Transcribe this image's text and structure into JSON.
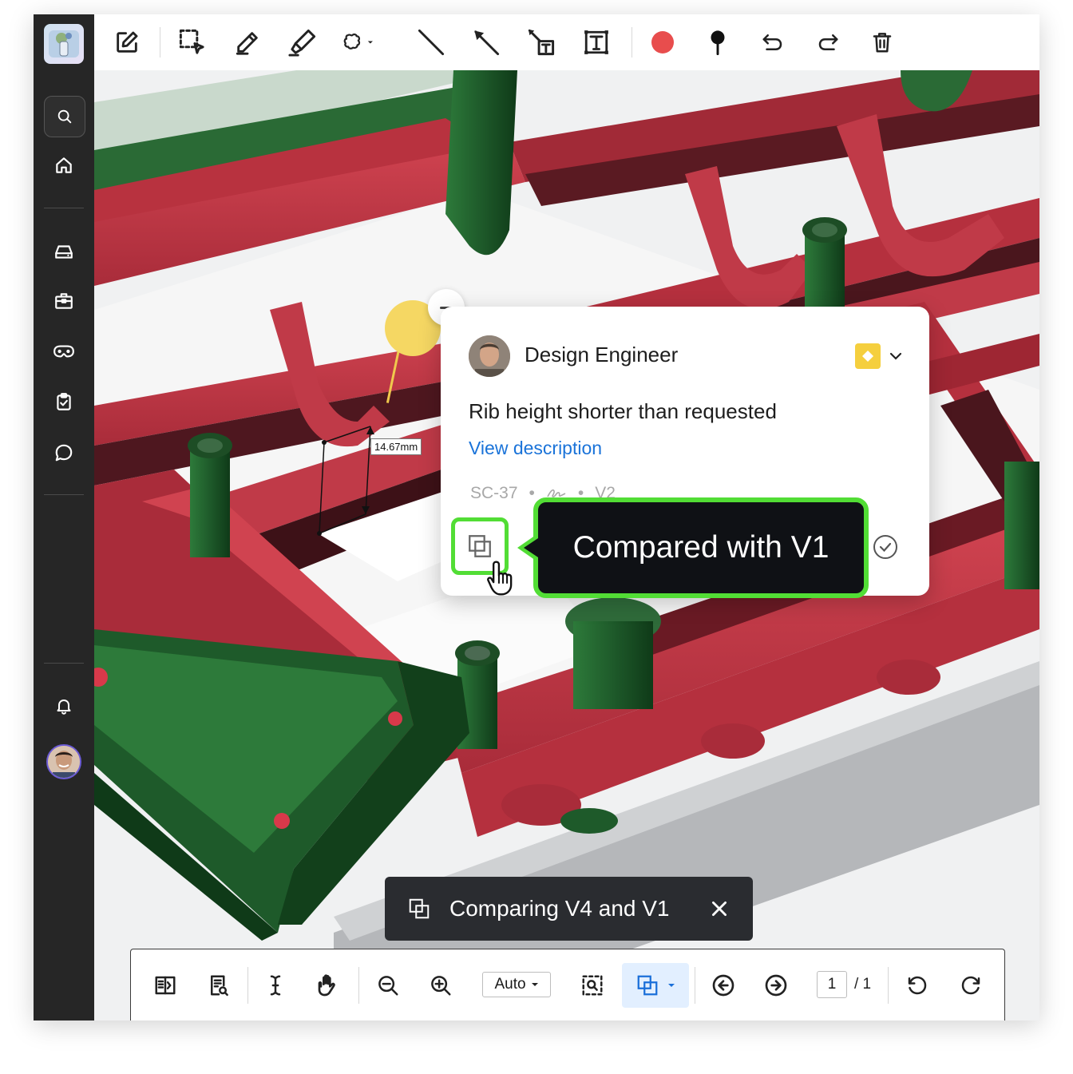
{
  "comment_card": {
    "author": "Design Engineer",
    "title": "Rib height shorter than requested",
    "link": "View description",
    "issue_id": "SC-37",
    "version": "V2"
  },
  "tooltip": {
    "text": "Compared with V1"
  },
  "measurement": {
    "label": "14.67mm"
  },
  "banner": {
    "text": "Comparing V4 and V1"
  },
  "bottom_toolbar": {
    "zoom_value": "Auto",
    "page_current": "1",
    "page_total": "/ 1"
  },
  "colors": {
    "accent_green": "#52dd35",
    "link_blue": "#1a73d9",
    "pin_yellow": "#f5d763",
    "record_red": "#e84d4d",
    "sidebar_bg": "#262626"
  },
  "icons": {
    "sidebar": [
      "search-icon",
      "home-icon",
      "drive-icon",
      "toolbox-icon",
      "vr-glasses-icon",
      "clipboard-icon",
      "chat-icon",
      "bell-icon"
    ],
    "toolbar": [
      "edit-icon",
      "select-area-icon",
      "pencil-icon",
      "highlighter-icon",
      "lasso-icon",
      "line-icon",
      "arrow-icon",
      "callout-text-icon",
      "text-box-icon",
      "color-swatch-icon",
      "pin-icon",
      "undo-icon",
      "redo-icon",
      "trash-icon"
    ]
  }
}
